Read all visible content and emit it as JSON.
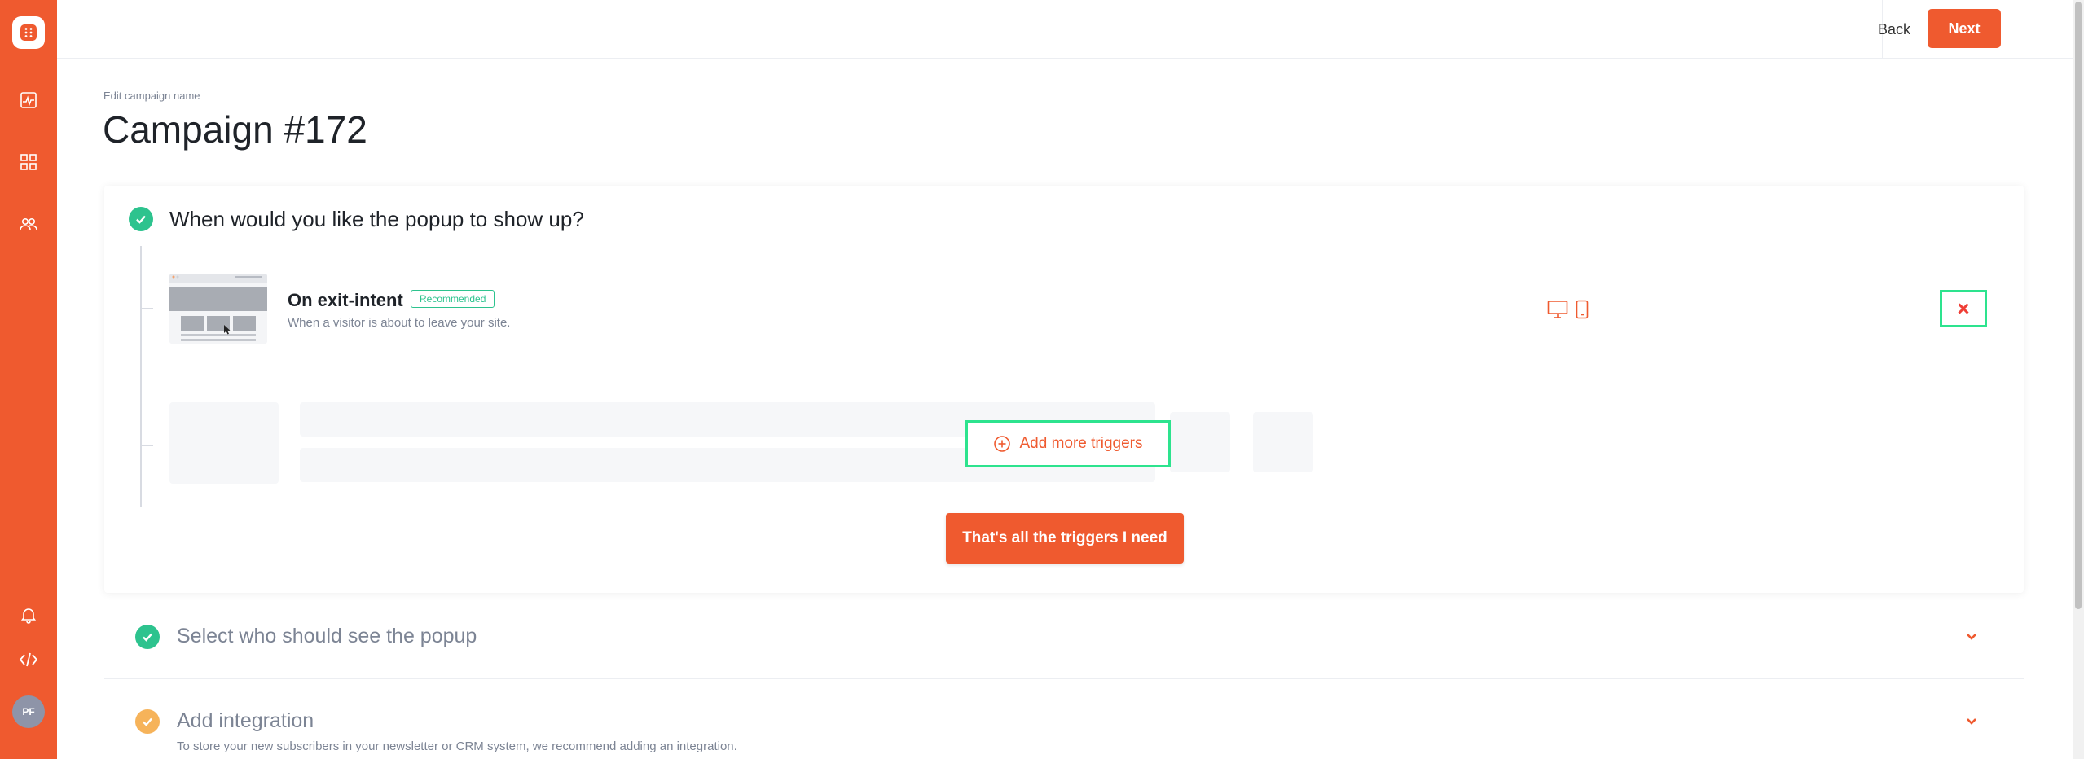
{
  "topbar": {
    "back_label": "Back",
    "next_label": "Next"
  },
  "sidebar": {
    "logo_icon": "grid-dots-icon",
    "items": [
      {
        "icon": "analytics-icon"
      },
      {
        "icon": "dashboard-grid-icon"
      },
      {
        "icon": "users-icon"
      }
    ],
    "bottom_items": [
      {
        "icon": "bell-icon"
      },
      {
        "icon": "code-icon"
      }
    ],
    "avatar_initials": "PF"
  },
  "header": {
    "edit_label": "Edit campaign name",
    "title": "Campaign #172"
  },
  "trigger_step": {
    "question": "When would you like the popup to show up?",
    "trigger": {
      "title": "On exit-intent",
      "badge": "Recommended",
      "description": "When a visitor is about to leave your site.",
      "devices": [
        "desktop-icon",
        "mobile-icon"
      ]
    },
    "add_more_label": "Add more triggers",
    "done_label": "That's all the triggers I need"
  },
  "sections": [
    {
      "title": "Select who should see the popup",
      "description": "",
      "status": "complete"
    },
    {
      "title": "Add integration",
      "description": "To store your new subscribers in your newsletter or CRM system, we recommend adding an integration.",
      "status": "warning"
    }
  ],
  "colors": {
    "brand": "#ef5a2f",
    "success": "#2dc38e",
    "warning": "#f6b35a",
    "highlight": "#2de38e"
  }
}
